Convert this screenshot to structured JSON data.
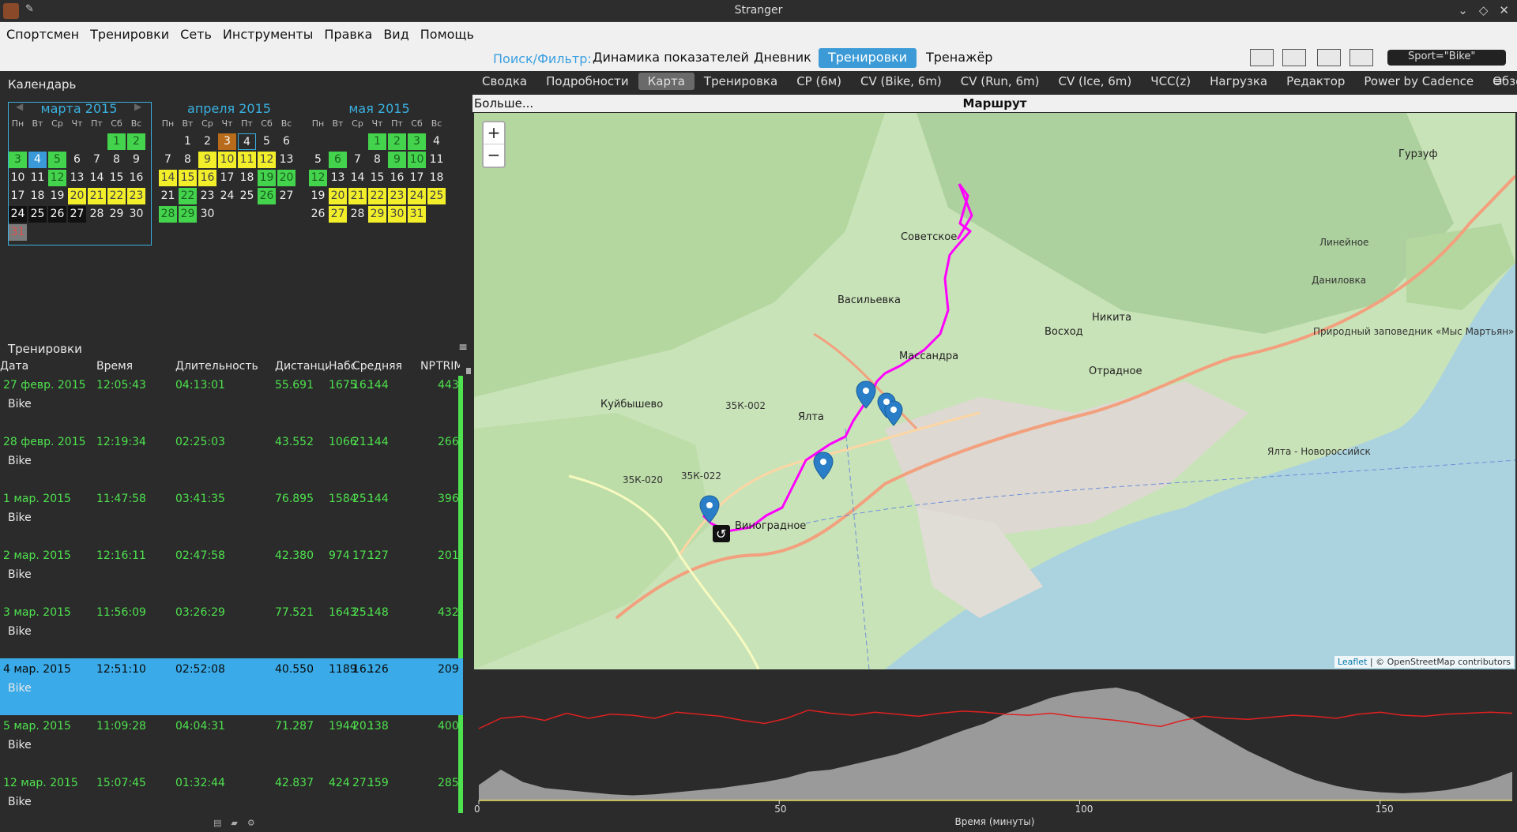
{
  "window": {
    "title": "Stranger"
  },
  "menu": [
    "Спортсмен",
    "Тренировки",
    "Сеть",
    "Инструменты",
    "Правка",
    "Вид",
    "Помощь"
  ],
  "toolbar": {
    "search_label": "Поиск/Фильтр:",
    "modes": [
      "Динамика показателей",
      "Дневник",
      "Тренировки",
      "Тренажёр"
    ],
    "active_mode": "Тренировки",
    "filter": "Sport=\"Bike\""
  },
  "calendar": {
    "header": "Календарь",
    "dow": [
      "Пн",
      "Вт",
      "Ср",
      "Чт",
      "Пт",
      "Сб",
      "Вс"
    ],
    "months": [
      {
        "title": "марта 2015",
        "start": 6,
        "days": 31,
        "styles": {
          "1": "green",
          "2": "green",
          "3": "green",
          "4": "blue",
          "5": "green",
          "12": "green",
          "20": "yellow",
          "21": "yellow",
          "22": "yellow",
          "23": "yellow",
          "24": "black",
          "25": "black",
          "26": "black",
          "27": "black",
          "31": "grey"
        }
      },
      {
        "title": "апреля 2015",
        "start": 2,
        "days": 30,
        "styles": {
          "3": "orange",
          "4": "outline",
          "5": "none",
          "9": "yellow",
          "10": "yellow",
          "11": "yellow",
          "12": "yellow",
          "14": "yellow",
          "15": "yellow",
          "16": "yellow",
          "19": "green",
          "20": "green",
          "22": "green",
          "26": "green",
          "28": "green",
          "29": "green"
        }
      },
      {
        "title": "мая 2015",
        "start": 4,
        "days": 31,
        "styles": {
          "1": "green",
          "2": "green",
          "3": "green",
          "6": "green",
          "9": "green",
          "10": "green",
          "12": "green",
          "20": "yellow",
          "21": "yellow",
          "22": "yellow",
          "23": "yellow",
          "24": "yellow",
          "25": "yellow",
          "27": "yellow",
          "29": "yellow",
          "30": "yellow",
          "31": "yellow"
        }
      }
    ]
  },
  "workouts": {
    "header": "Тренировки",
    "columns": [
      "Дата",
      "Время",
      "Длительность",
      "Дистанция",
      "Набор",
      "Средняя",
      "NP",
      "TRIMP"
    ],
    "rows": [
      {
        "date": "27 февр. 2015",
        "time": "12:05:43",
        "dur": "04:13:01",
        "dist": "55.691",
        "gain": "1675",
        "avg": "16.:",
        "np": "144",
        "trimp": "443",
        "sport": "Bike"
      },
      {
        "date": "28 февр. 2015",
        "time": "12:19:34",
        "dur": "02:25:03",
        "dist": "43.552",
        "gain": "1066",
        "avg": "21.:",
        "np": "144",
        "trimp": "266",
        "sport": "Bike"
      },
      {
        "date": "1 мар. 2015",
        "time": "11:47:58",
        "dur": "03:41:35",
        "dist": "76.895",
        "gain": "1584",
        "avg": "25.:",
        "np": "144",
        "trimp": "396",
        "sport": "Bike"
      },
      {
        "date": "2 мар. 2015",
        "time": "12:16:11",
        "dur": "02:47:58",
        "dist": "42.380",
        "gain": "974",
        "avg": "17.:",
        "np": "127",
        "trimp": "201",
        "sport": "Bike"
      },
      {
        "date": "3 мар. 2015",
        "time": "11:56:09",
        "dur": "03:26:29",
        "dist": "77.521",
        "gain": "1643",
        "avg": "25.:",
        "np": "148",
        "trimp": "432",
        "sport": "Bike"
      },
      {
        "date": "4 мар. 2015",
        "time": "12:51:10",
        "dur": "02:52:08",
        "dist": "40.550",
        "gain": "1189",
        "avg": "16.:",
        "np": "126",
        "trimp": "209",
        "sport": "Bike",
        "selected": true
      },
      {
        "date": "5 мар. 2015",
        "time": "11:09:28",
        "dur": "04:04:31",
        "dist": "71.287",
        "gain": "1944",
        "avg": "20.:",
        "np": "138",
        "trimp": "400",
        "sport": "Bike"
      },
      {
        "date": "12 мар. 2015",
        "time": "15:07:45",
        "dur": "01:32:44",
        "dist": "42.837",
        "gain": "424",
        "avg": "27.:",
        "np": "159",
        "trimp": "285",
        "sport": "Bike"
      }
    ]
  },
  "tabs": [
    "Сводка",
    "Подробности",
    "Карта",
    "Тренировка",
    "CP (6м)",
    "CV (Bike, 6m)",
    "CV (Run, 6m)",
    "CV (Ice, 6m)",
    "ЧСС(z)",
    "Нагрузка",
    "Редактор",
    "Power by Cadence",
    "Обзор"
  ],
  "active_tab": "Карта",
  "map": {
    "more_label": "Больше...",
    "title": "Маршрут",
    "attribution_leaflet": "Leaflet",
    "attribution_rest": " | © OpenStreetMap contributors",
    "osm": "OpenStreetMap",
    "labels": [
      {
        "t": "Гурзуф",
        "big": true
      },
      {
        "t": "Советское",
        "big": true
      },
      {
        "t": "Васильевка",
        "big": true
      },
      {
        "t": "Никита",
        "big": true
      },
      {
        "t": "Восход",
        "big": true
      },
      {
        "t": "Массандра",
        "big": true
      },
      {
        "t": "Отрадное",
        "big": true
      },
      {
        "t": "Ялта",
        "big": true
      },
      {
        "t": "Куйбышево",
        "big": true
      },
      {
        "t": "Виноградное",
        "big": true
      },
      {
        "t": "Линейное",
        "big": false
      },
      {
        "t": "Даниловка",
        "big": false
      },
      {
        "t": "Природный заповедник «Мыс Мартьян»",
        "big": false
      },
      {
        "t": "35К-002",
        "big": false
      },
      {
        "t": "35К-020",
        "big": false
      },
      {
        "t": "35К-022",
        "big": false
      },
      {
        "t": "Ялта - Новороссийск",
        "big": false
      }
    ]
  },
  "chart_data": {
    "type": "area",
    "xlabel": "Время (минуты)",
    "x_ticks": [
      0,
      50,
      100,
      150
    ],
    "xlim": [
      0,
      172
    ],
    "series": [
      {
        "values": [
          15,
          30,
          18,
          12,
          10,
          8,
          6,
          5,
          6,
          8,
          10,
          12,
          15,
          18,
          22,
          28,
          30,
          35,
          40,
          45,
          52,
          60,
          68,
          75,
          85,
          92,
          100,
          105,
          108,
          110,
          105,
          95,
          85,
          72,
          60,
          48,
          38,
          28,
          20,
          14,
          10,
          8,
          7,
          8,
          10,
          14,
          20,
          28
        ]
      },
      {
        "values": [
          70,
          80,
          82,
          78,
          85,
          80,
          84,
          83,
          80,
          86,
          84,
          82,
          78,
          75,
          80,
          88,
          85,
          83,
          86,
          84,
          82,
          85,
          87,
          86,
          84,
          83,
          85,
          82,
          80,
          78,
          75,
          72,
          78,
          82,
          80,
          79,
          81,
          83,
          82,
          80,
          84,
          86,
          83,
          82,
          84,
          85,
          86,
          85
        ]
      }
    ]
  }
}
